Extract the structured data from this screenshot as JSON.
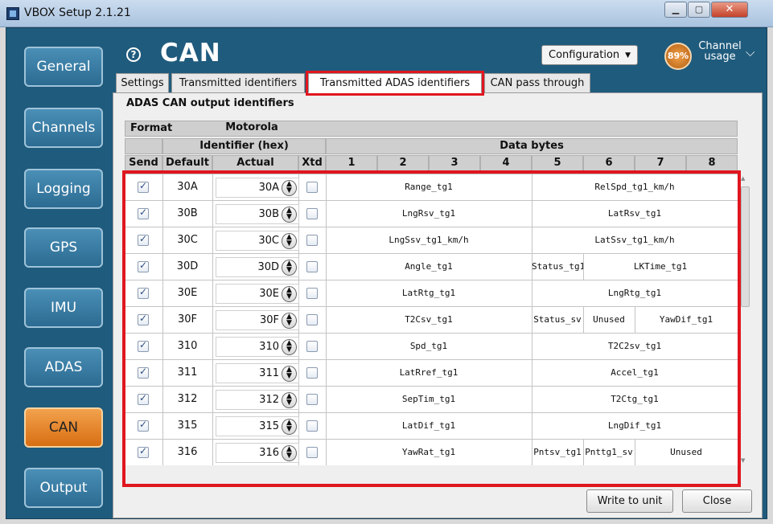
{
  "window": {
    "title": "VBOX Setup 2.1.21"
  },
  "sidebar": {
    "items": [
      {
        "label": "General",
        "active": false
      },
      {
        "label": "Channels",
        "active": false
      },
      {
        "label": "Logging",
        "active": false
      },
      {
        "label": "GPS",
        "active": false
      },
      {
        "label": "IMU",
        "active": false
      },
      {
        "label": "ADAS",
        "active": false
      },
      {
        "label": "CAN",
        "active": true
      },
      {
        "label": "Output",
        "active": false
      }
    ]
  },
  "header": {
    "title": "CAN",
    "help_icon": "?",
    "configuration_label": "Configuration",
    "channel_usage_percent": "89%",
    "channel_usage_label": "Channel usage"
  },
  "tabs": [
    {
      "label": "Settings",
      "active": false
    },
    {
      "label": "Transmitted identifiers",
      "active": false
    },
    {
      "label": "Transmitted ADAS identifiers",
      "active": true
    },
    {
      "label": "CAN pass through",
      "active": false
    }
  ],
  "section": {
    "title": "ADAS CAN output identifiers"
  },
  "table": {
    "format_label": "Format",
    "format_value": "Motorola",
    "identifier_group": "Identifier (hex)",
    "data_group": "Data bytes",
    "col_send": "Send",
    "col_default": "Default",
    "col_actual": "Actual",
    "col_xtd": "Xtd",
    "byte_numbers": [
      "1",
      "2",
      "3",
      "4",
      "5",
      "6",
      "7",
      "8"
    ],
    "rows": [
      {
        "send": true,
        "default": "30A",
        "actual": "30A",
        "xtd": false,
        "signals": [
          "Range_tg1",
          "RelSpd_tg1_km/h"
        ]
      },
      {
        "send": true,
        "default": "30B",
        "actual": "30B",
        "xtd": false,
        "signals": [
          "LngRsv_tg1",
          "LatRsv_tg1"
        ]
      },
      {
        "send": true,
        "default": "30C",
        "actual": "30C",
        "xtd": false,
        "signals": [
          "LngSsv_tg1_km/h",
          "LatSsv_tg1_km/h"
        ]
      },
      {
        "send": true,
        "default": "30D",
        "actual": "30D",
        "xtd": false,
        "signals": [
          "Angle_tg1",
          "Status_tg1",
          "LKTime_tg1"
        ]
      },
      {
        "send": true,
        "default": "30E",
        "actual": "30E",
        "xtd": false,
        "signals": [
          "LatRtg_tg1",
          "LngRtg_tg1"
        ]
      },
      {
        "send": true,
        "default": "30F",
        "actual": "30F",
        "xtd": false,
        "signals": [
          "T2Csv_tg1",
          "Status_sv",
          "Unused",
          "YawDif_tg1"
        ]
      },
      {
        "send": true,
        "default": "310",
        "actual": "310",
        "xtd": false,
        "signals": [
          "Spd_tg1",
          "T2C2sv_tg1"
        ]
      },
      {
        "send": true,
        "default": "311",
        "actual": "311",
        "xtd": false,
        "signals": [
          "LatRref_tg1",
          "Accel_tg1"
        ]
      },
      {
        "send": true,
        "default": "312",
        "actual": "312",
        "xtd": false,
        "signals": [
          "SepTim_tg1",
          "T2Ctg_tg1"
        ]
      },
      {
        "send": true,
        "default": "315",
        "actual": "315",
        "xtd": false,
        "signals": [
          "LatDif_tg1",
          "LngDif_tg1"
        ]
      },
      {
        "send": true,
        "default": "316",
        "actual": "316",
        "xtd": false,
        "signals": [
          "YawRat_tg1",
          "Pntsv_tg1",
          "Pnttg1_sv",
          "Unused"
        ]
      }
    ]
  },
  "footer": {
    "write_label": "Write to unit",
    "close_label": "Close"
  },
  "icons": {
    "help": "question-circle-icon",
    "dropdown": "chevron-down-icon",
    "spinner": "up-down-arrows-icon"
  },
  "colors": {
    "app_background": "#1f5b7d",
    "nav_button": "#3a7ea6",
    "nav_active": "#e8841e",
    "highlight_box": "#e0161f"
  }
}
